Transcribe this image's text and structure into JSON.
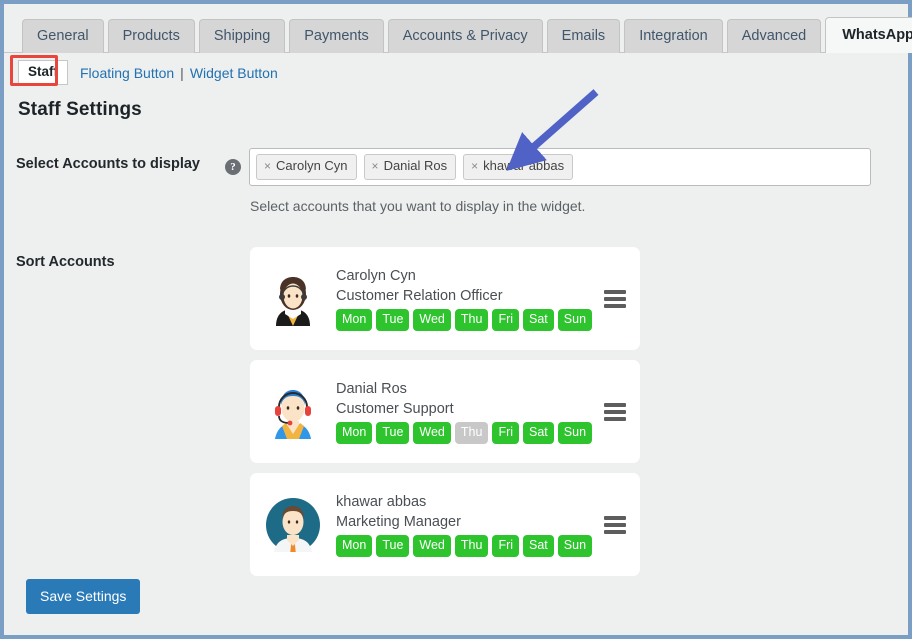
{
  "tabs": [
    {
      "label": "General",
      "active": false
    },
    {
      "label": "Products",
      "active": false
    },
    {
      "label": "Shipping",
      "active": false
    },
    {
      "label": "Payments",
      "active": false
    },
    {
      "label": "Accounts & Privacy",
      "active": false
    },
    {
      "label": "Emails",
      "active": false
    },
    {
      "label": "Integration",
      "active": false
    },
    {
      "label": "Advanced",
      "active": false
    },
    {
      "label": "WhatsApp Chat",
      "active": true
    }
  ],
  "subnav": {
    "current": "Staff",
    "links": [
      "Floating Button",
      "Widget Button"
    ],
    "separator": "|"
  },
  "page_title": "Staff Settings",
  "select_accounts": {
    "label": "Select Accounts to display",
    "help_icon": "question-mark-icon",
    "help_glyph": "?",
    "tokens": [
      {
        "remove": "×",
        "label": "Carolyn Cyn"
      },
      {
        "remove": "×",
        "label": "Danial Ros"
      },
      {
        "remove": "×",
        "label": "khawar abbas"
      }
    ],
    "hint": "Select accounts that you want to display in the widget."
  },
  "sort_accounts": {
    "label": "Sort Accounts",
    "cards": [
      {
        "name": "Carolyn Cyn",
        "role": "Customer Relation Officer",
        "avatar": "female-agent-avatar",
        "days": [
          {
            "label": "Mon",
            "on": true
          },
          {
            "label": "Tue",
            "on": true
          },
          {
            "label": "Wed",
            "on": true
          },
          {
            "label": "Thu",
            "on": true
          },
          {
            "label": "Fri",
            "on": true
          },
          {
            "label": "Sat",
            "on": true
          },
          {
            "label": "Sun",
            "on": true
          }
        ]
      },
      {
        "name": "Danial Ros",
        "role": "Customer Support",
        "avatar": "male-headset-avatar",
        "days": [
          {
            "label": "Mon",
            "on": true
          },
          {
            "label": "Tue",
            "on": true
          },
          {
            "label": "Wed",
            "on": true
          },
          {
            "label": "Thu",
            "on": false
          },
          {
            "label": "Fri",
            "on": true
          },
          {
            "label": "Sat",
            "on": true
          },
          {
            "label": "Sun",
            "on": true
          }
        ]
      },
      {
        "name": "khawar abbas",
        "role": "Marketing Manager",
        "avatar": "male-suit-avatar",
        "days": [
          {
            "label": "Mon",
            "on": true
          },
          {
            "label": "Tue",
            "on": true
          },
          {
            "label": "Wed",
            "on": true
          },
          {
            "label": "Thu",
            "on": true
          },
          {
            "label": "Fri",
            "on": true
          },
          {
            "label": "Sat",
            "on": true
          },
          {
            "label": "Sun",
            "on": true
          }
        ]
      }
    ],
    "drag_handle_icon": "drag-handle-icon"
  },
  "save_button": "Save Settings",
  "annotations": {
    "arrow": {
      "icon": "arrow-pointer-icon",
      "color": "#5062c6",
      "points_to": "khawar abbas"
    },
    "highlight_box": {
      "icon": "highlight-box",
      "color": "#e8453c",
      "around": "Staff"
    }
  },
  "colors": {
    "accent_blue": "#2b7ab8",
    "link_blue": "#2271b1",
    "day_on": "#2ec42e",
    "day_off": "#c8c8c8",
    "frame": "#7b9ec4",
    "page_bg": "#eef0ef"
  }
}
